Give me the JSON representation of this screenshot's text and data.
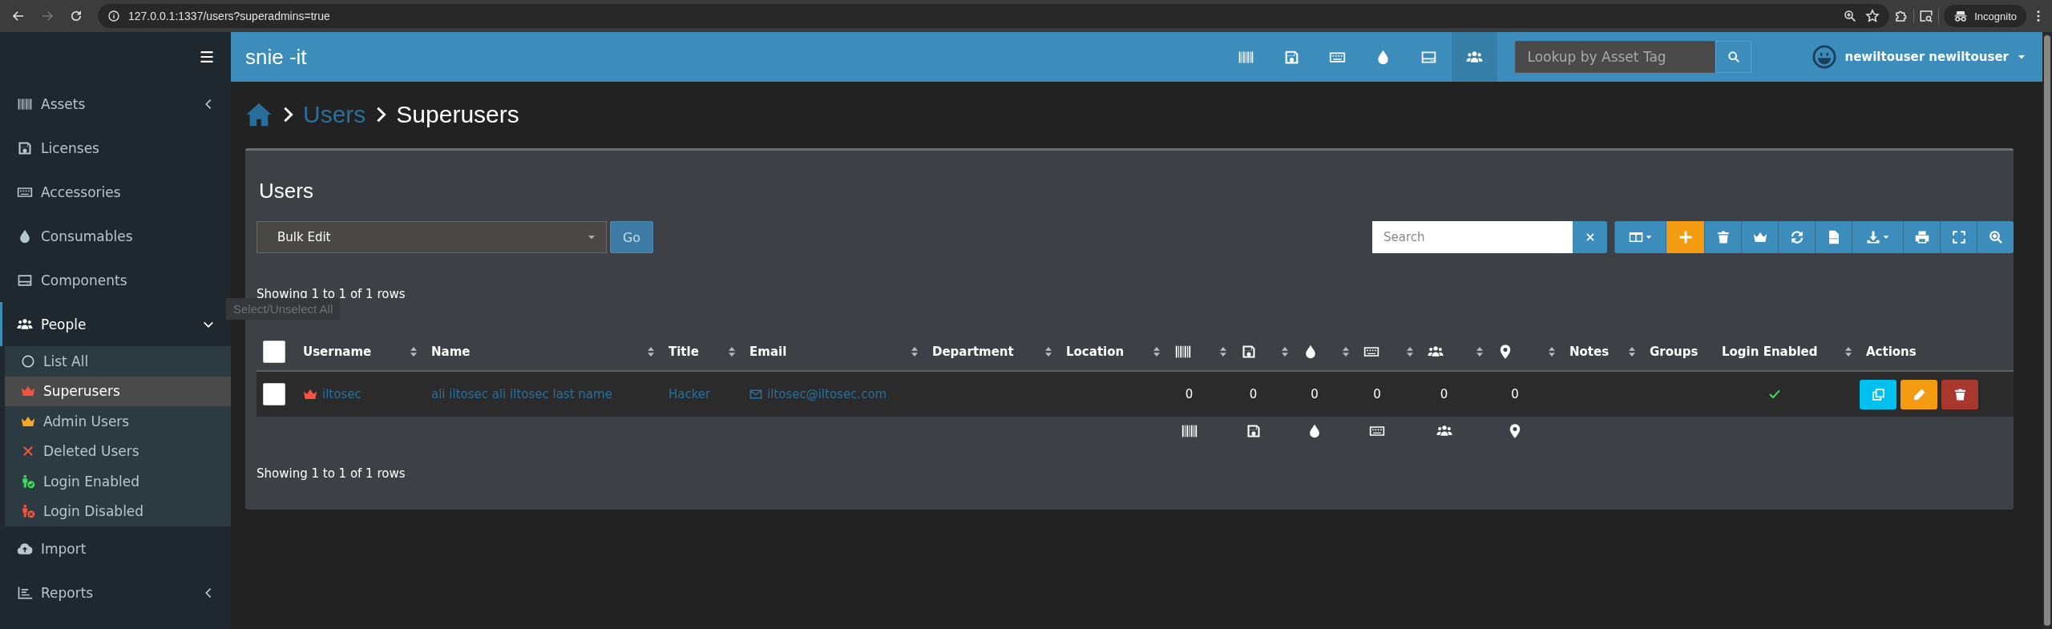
{
  "browser": {
    "nav_buttons": [
      {
        "kind": "back",
        "disabled": false
      },
      {
        "kind": "forward",
        "disabled": true
      },
      {
        "kind": "reload",
        "disabled": false
      }
    ],
    "url": "127.0.0.1:1337/users?superadmins=true",
    "profile": "Incognito"
  },
  "header": {
    "brand": "snie -it",
    "nav_icons": [
      {
        "kind": "barcode",
        "selected": false
      },
      {
        "kind": "save",
        "selected": false
      },
      {
        "kind": "keyboard",
        "selected": false
      },
      {
        "kind": "drop",
        "selected": false
      },
      {
        "kind": "drive",
        "selected": false
      },
      {
        "kind": "people",
        "selected": true
      }
    ],
    "lookup": {
      "placeholder": "Lookup by Asset Tag"
    },
    "user": "newiltouser newiltouser"
  },
  "sidebar": {
    "items": [
      {
        "kind": "barcode",
        "label": "Assets",
        "expanded": false
      },
      {
        "kind": "save",
        "label": "Licenses"
      },
      {
        "kind": "keyboard",
        "label": "Accessories"
      },
      {
        "kind": "drop",
        "label": "Consumables"
      },
      {
        "kind": "drive",
        "label": "Components"
      },
      {
        "kind": "people",
        "label": "People",
        "expanded": true,
        "children": [
          {
            "kind": "circle",
            "label": "List All",
            "color": "#d2d6de",
            "selected": false
          },
          {
            "kind": "crown",
            "label": "Superusers",
            "color": "#f4533d",
            "selected": true
          },
          {
            "kind": "crown",
            "label": "Admin Users",
            "color": "#f5a623",
            "selected": false
          },
          {
            "kind": "x",
            "label": "Deleted Users",
            "color": "#f4533d",
            "selected": false
          },
          {
            "kind": "person-check",
            "label": "Login Enabled",
            "color": "#3ddc5b",
            "selected": false
          },
          {
            "kind": "person-x",
            "label": "Login Disabled",
            "color": "#f4533d",
            "selected": false
          }
        ]
      },
      {
        "kind": "cloud",
        "label": "Import"
      },
      {
        "kind": "chart",
        "label": "Reports",
        "expanded": false
      }
    ]
  },
  "breadcrumb": [
    {
      "kind": "link",
      "label": "Users"
    },
    {
      "kind": "current",
      "label": "Superusers"
    }
  ],
  "panel": {
    "title": "Users",
    "bulk_action": {
      "value": "Bulk Edit"
    },
    "go_button": "Go",
    "search": {
      "placeholder": "Search"
    },
    "toolbar": [
      {
        "kind": "columns",
        "color": "#3c8dbc"
      },
      {
        "kind": "plus",
        "color": "#f39c12"
      },
      {
        "kind": "trash",
        "color": "#3c8dbc"
      },
      {
        "kind": "crown",
        "color": "#3c8dbc"
      },
      {
        "kind": "refresh",
        "color": "#3c8dbc"
      },
      {
        "kind": "csv",
        "color": "#3c8dbc"
      },
      {
        "kind": "download",
        "color": "#3c8dbc"
      },
      {
        "kind": "print",
        "color": "#3c8dbc"
      },
      {
        "kind": "fullscreen",
        "color": "#3c8dbc"
      },
      {
        "kind": "zoom",
        "color": "#3c8dbc"
      }
    ],
    "summary_top": "Showing 1 to 1 of 1 rows",
    "tooltip": "Select/Unselect All",
    "select_all": {
      "checked": false
    },
    "columns": [
      {
        "kind": "text",
        "label": "Username",
        "sortable": true
      },
      {
        "kind": "text",
        "label": "Name",
        "sortable": true
      },
      {
        "kind": "text",
        "label": "Title",
        "sortable": true
      },
      {
        "kind": "text",
        "label": "Email",
        "sortable": true
      },
      {
        "kind": "text",
        "label": "Department",
        "sortable": true
      },
      {
        "kind": "text",
        "label": "Location",
        "sortable": true
      },
      {
        "kind": "barcode",
        "sortable": true
      },
      {
        "kind": "save",
        "sortable": true
      },
      {
        "kind": "drop",
        "sortable": true
      },
      {
        "kind": "keyboard",
        "sortable": true
      },
      {
        "kind": "people",
        "sortable": true
      },
      {
        "kind": "pin",
        "sortable": true
      },
      {
        "kind": "text",
        "label": "Notes",
        "sortable": true
      },
      {
        "kind": "text",
        "label": "Groups",
        "sortable": false
      },
      {
        "kind": "text",
        "label": "Login Enabled",
        "sortable": true
      },
      {
        "kind": "text",
        "label": "Actions",
        "sortable": false
      }
    ],
    "rows": [
      {
        "checked": false,
        "superuser": true,
        "username": "iltosec",
        "name": "ali iltosec ali iltosec last name",
        "title": "Hacker",
        "email": "iltosec@iltosec.com",
        "counts": [
          "0",
          "0",
          "0",
          "0",
          "0",
          "0"
        ],
        "login_enabled": true,
        "actions": [
          {
            "kind": "copy",
            "color": "#00c0ef"
          },
          {
            "kind": "pencil",
            "color": "#f39c12"
          },
          {
            "kind": "trash",
            "color": "#a8382d"
          }
        ]
      }
    ],
    "summary_bottom": "Showing 1 to 1 of 1 rows"
  }
}
